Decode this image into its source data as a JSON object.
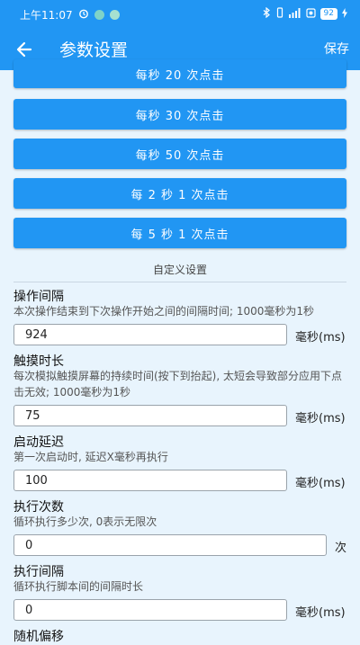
{
  "status_bar": {
    "time": "上午11:07",
    "battery": "92"
  },
  "app_bar": {
    "title": "参数设置",
    "save": "保存"
  },
  "presets": [
    "每秒 20 次点击",
    "每秒 30 次点击",
    "每秒 50 次点击",
    "每 2 秒 1 次点击",
    "每 5 秒 1 次点击"
  ],
  "custom": {
    "section_title": "自定义设置",
    "interval": {
      "label": "操作间隔",
      "desc": "本次操作结束到下次操作开始之间的间隔时间; 1000毫秒为1秒",
      "value": "924",
      "unit": "毫秒(ms)"
    },
    "touch": {
      "label": "触摸时长",
      "desc": "每次模拟触摸屏幕的持续时间(按下到抬起), 太短会导致部分应用下点击无效; 1000毫秒为1秒",
      "value": "75",
      "unit": "毫秒(ms)"
    },
    "delay": {
      "label": "启动延迟",
      "desc": "第一次启动时, 延迟X毫秒再执行",
      "value": "100",
      "unit": "毫秒(ms)"
    },
    "count": {
      "label": "执行次数",
      "desc": "循环执行多少次, 0表示无限次",
      "value": "0",
      "unit": "次"
    },
    "loop_interval": {
      "label": "执行间隔",
      "desc": "循环执行脚本间的间隔时长",
      "value": "0",
      "unit": "毫秒(ms)"
    },
    "random_offset": {
      "label": "随机偏移"
    }
  }
}
